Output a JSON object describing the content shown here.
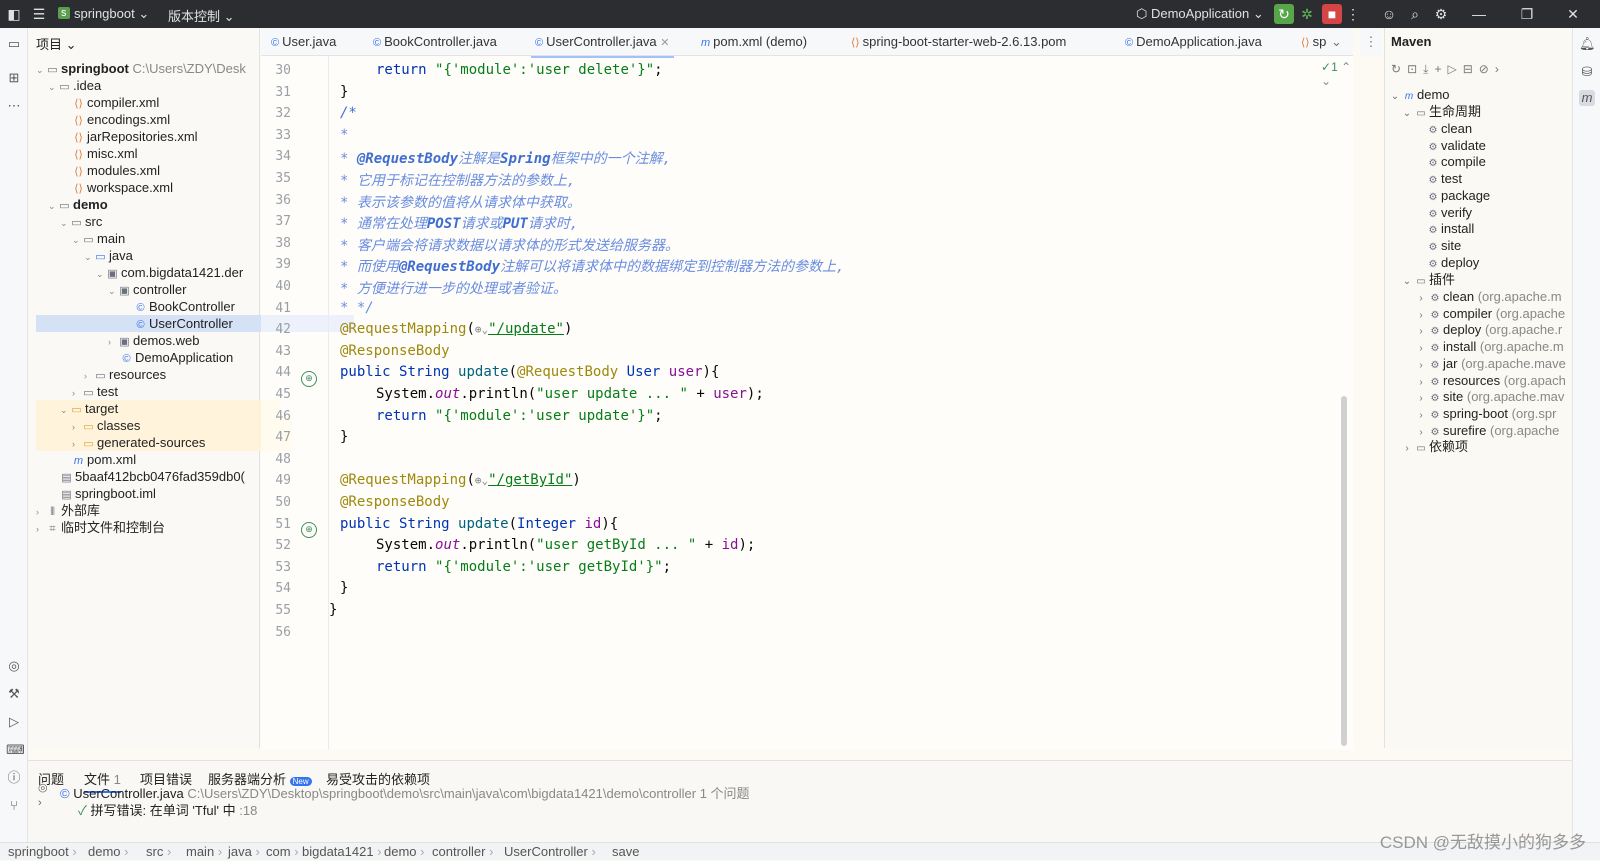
{
  "titlebar": {
    "project": "springboot",
    "vcs": "版本控制",
    "run_config": "DemoApplication"
  },
  "project_panel": {
    "title": "项目",
    "tree": [
      {
        "label": "springboot",
        "extra": "C:\\Users\\ZDY\\Desk",
        "icon": "folder-icon",
        "bold": true
      },
      {
        "label": ".idea",
        "icon": "folder-icon"
      },
      {
        "label": "compiler.xml",
        "icon": "xml-file-icon"
      },
      {
        "label": "encodings.xml",
        "icon": "xml-file-icon"
      },
      {
        "label": "jarRepositories.xml",
        "icon": "xml-file-icon"
      },
      {
        "label": "misc.xml",
        "icon": "xml-file-icon"
      },
      {
        "label": "modules.xml",
        "icon": "xml-file-icon"
      },
      {
        "label": "workspace.xml",
        "icon": "xml-file-icon"
      },
      {
        "label": "demo",
        "icon": "folder-icon",
        "bold": true
      },
      {
        "label": "src",
        "icon": "folder-icon"
      },
      {
        "label": "main",
        "icon": "folder-icon"
      },
      {
        "label": "java",
        "icon": "folder-icon"
      },
      {
        "label": "com.bigdata1421.der",
        "icon": "package-icon"
      },
      {
        "label": "controller",
        "icon": "package-icon"
      },
      {
        "label": "BookController",
        "icon": "class-icon"
      },
      {
        "label": "UserController",
        "icon": "class-icon"
      },
      {
        "label": "demos.web",
        "icon": "package-icon"
      },
      {
        "label": "DemoApplication",
        "icon": "class-icon"
      },
      {
        "label": "resources",
        "icon": "folder-icon"
      },
      {
        "label": "test",
        "icon": "folder-icon"
      },
      {
        "label": "target",
        "icon": "folder-icon"
      },
      {
        "label": "classes",
        "icon": "folder-icon"
      },
      {
        "label": "generated-sources",
        "icon": "folder-icon"
      },
      {
        "label": "pom.xml",
        "icon": "maven-file-icon"
      },
      {
        "label": "5baaf412bcb0476fad359db0(",
        "icon": "file-icon"
      },
      {
        "label": "springboot.iml",
        "icon": "file-icon"
      },
      {
        "label": "外部库",
        "icon": "library-icon"
      },
      {
        "label": "临时文件和控制台",
        "icon": "scratch-icon"
      }
    ]
  },
  "editor_tabs": [
    {
      "label": "User.java",
      "icon": "class-icon"
    },
    {
      "label": "BookController.java",
      "icon": "class-icon"
    },
    {
      "label": "UserController.java",
      "icon": "class-icon"
    },
    {
      "label": "pom.xml (demo)",
      "icon": "maven-file-icon"
    },
    {
      "label": "spring-boot-starter-web-2.6.13.pom",
      "icon": "xml-file-icon"
    },
    {
      "label": "DemoApplication.java",
      "icon": "class-icon"
    },
    {
      "label": "sp",
      "icon": "xml-file-icon"
    }
  ],
  "editor": {
    "inspection_count": "1",
    "line_numbers": [
      "30",
      "31",
      "32",
      "33",
      "34",
      "35",
      "36",
      "37",
      "38",
      "39",
      "40",
      "41",
      "42",
      "43",
      "44",
      "45",
      "46",
      "47",
      "48",
      "49",
      "50",
      "51",
      "52",
      "53",
      "54",
      "55",
      "56"
    ],
    "code": {
      "l30_return": "return",
      "l30_str": "\"{'module':'user delete'}\"",
      "l30_end": ";",
      "l31": "}",
      "l32": "/*",
      "l33": "*",
      "l34_a": "* ",
      "l34_b": "@RequestBody",
      "l34_c": "注解是",
      "l34_d": "Spring",
      "l34_e": "框架中的一个注解,",
      "l35": "* 它用于标记在控制器方法的参数上,",
      "l36": "* 表示该参数的值将从请求体中获取。",
      "l37_a": "* 通常在处理",
      "l37_b": "POST",
      "l37_c": "请求或",
      "l37_d": "PUT",
      "l37_e": "请求时,",
      "l38": "* 客户端会将请求数据以请求体的形式发送给服务器。",
      "l39_a": "* 而使用",
      "l39_b": "@RequestBody",
      "l39_c": "注解可以将请求体中的数据绑定到控制器方法的参数上,",
      "l40": "* 方便进行进一步的处理或者验证。",
      "l41": "* */",
      "l42_ann": "@RequestMapping",
      "l42_paren": "(",
      "l42_path": "\"/update\"",
      "l42_close": ")",
      "l43": "@ResponseBody",
      "l44_kw": "public",
      "l44_type": "String",
      "l44_meth": "update",
      "l44_open": "(",
      "l44_ann": "@RequestBody",
      "l44_ptype": "User",
      "l44_param": "user",
      "l44_close": "){",
      "l45_sys": "System.",
      "l45_out": "out",
      "l45_mid": ".println(",
      "l45_str": "\"user update ... \"",
      "l45_plus": " + ",
      "l45_var": "user",
      "l45_end": ");",
      "l46_return": "return",
      "l46_str": "\"{'module':'user update'}\"",
      "l46_end": ";",
      "l47": "}",
      "l49_ann": "@RequestMapping",
      "l49_paren": "(",
      "l49_path": "\"/getById\"",
      "l49_close": ")",
      "l50": "@ResponseBody",
      "l51_kw": "public",
      "l51_type": "String",
      "l51_meth": "update",
      "l51_open": "(",
      "l51_ptype": "Integer",
      "l51_param": "id",
      "l51_close": "){",
      "l52_sys": "System.",
      "l52_out": "out",
      "l52_mid": ".println(",
      "l52_str": "\"user getById ... \"",
      "l52_plus": " + ",
      "l52_var": "id",
      "l52_end": ");",
      "l53_return": "return",
      "l53_str": "\"{'module':'user getById'}\"",
      "l53_end": ";",
      "l54": "}",
      "l55": "}"
    }
  },
  "maven_panel": {
    "title": "Maven",
    "root": "demo",
    "lifecycle_label": "生命周期",
    "lifecycle": [
      "clean",
      "validate",
      "compile",
      "test",
      "package",
      "verify",
      "install",
      "site",
      "deploy"
    ],
    "plugins_label": "插件",
    "plugins": [
      {
        "name": "clean",
        "extra": "(org.apache.m"
      },
      {
        "name": "compiler",
        "extra": "(org.apache"
      },
      {
        "name": "deploy",
        "extra": "(org.apache.r"
      },
      {
        "name": "install",
        "extra": "(org.apache.m"
      },
      {
        "name": "jar",
        "extra": "(org.apache.mave"
      },
      {
        "name": "resources",
        "extra": "(org.apach"
      },
      {
        "name": "site",
        "extra": "(org.apache.mav"
      },
      {
        "name": "spring-boot",
        "extra": "(org.spr"
      },
      {
        "name": "surefire",
        "extra": "(org.apache"
      }
    ],
    "dependencies_label": "依赖项"
  },
  "bottom_panel": {
    "tabs": [
      "问题",
      "文件",
      "项目错误",
      "服务器端分析",
      "易受攻击的依赖项"
    ],
    "file_count": "1",
    "new_badge": "New",
    "problem_file": "UserController.java",
    "problem_path": "C:\\Users\\ZDY\\Desktop\\springboot\\demo\\src\\main\\java\\com\\bigdata1421\\demo\\controller",
    "problem_count": "1 个问题",
    "problem_item": "拼写错误: 在单词 'Tful' 中",
    "problem_pos": ":18"
  },
  "statusbar": {
    "breadcrumbs": [
      "springboot",
      "demo",
      "src",
      "main",
      "java",
      "com",
      "bigdata1421",
      "demo",
      "controller",
      "UserController",
      "save"
    ]
  },
  "overlay": {
    "watermark": "CSDN @无敌摸小的狗多多"
  }
}
